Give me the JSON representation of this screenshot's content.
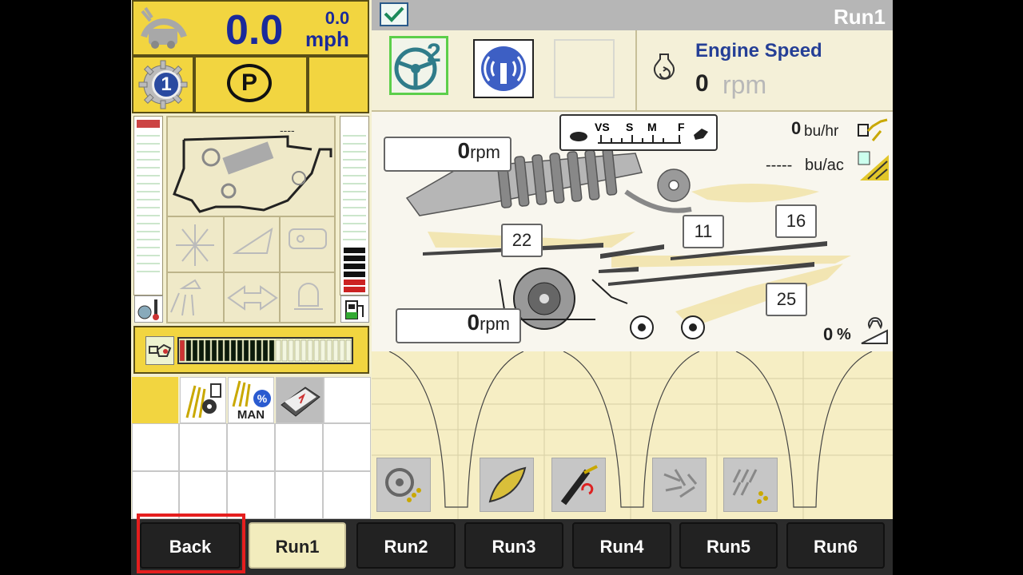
{
  "speed": {
    "value": "0.0",
    "unit_top": "0.0",
    "unit": "mph"
  },
  "gear": "1",
  "park": "P",
  "machine": {
    "label": "----"
  },
  "header": {
    "title": "Run1"
  },
  "engine": {
    "title": "Engine Speed",
    "value": "0",
    "unit": "rpm"
  },
  "speed_scale": {
    "labels": [
      "VS",
      "S",
      "M",
      "F"
    ]
  },
  "yield": {
    "bu_hr_value": "0",
    "bu_hr_unit": "bu/hr",
    "bu_ac_value": "-----",
    "bu_ac_unit": "bu/ac"
  },
  "rpm_upper": {
    "value": "0",
    "unit": "rpm"
  },
  "rpm_lower": {
    "value": "0",
    "unit": "rpm"
  },
  "sieves": {
    "a": "22",
    "b": "11",
    "c": "16",
    "d": "25"
  },
  "slope": {
    "value": "0",
    "unit": "%"
  },
  "grain_bar": {
    "filled_segments": 15,
    "total_segments": 27
  },
  "icons": {
    "auto_tune": "MAN",
    "tile_number": "2"
  },
  "tabs": [
    {
      "label": "Back"
    },
    {
      "label": "Run1"
    },
    {
      "label": "Run2"
    },
    {
      "label": "Run3"
    },
    {
      "label": "Run4"
    },
    {
      "label": "Run5"
    },
    {
      "label": "Run6"
    }
  ],
  "colors": {
    "accent_yellow": "#f2d540",
    "blue_text": "#1a2a9a",
    "highlight_red": "#e51e1e"
  }
}
